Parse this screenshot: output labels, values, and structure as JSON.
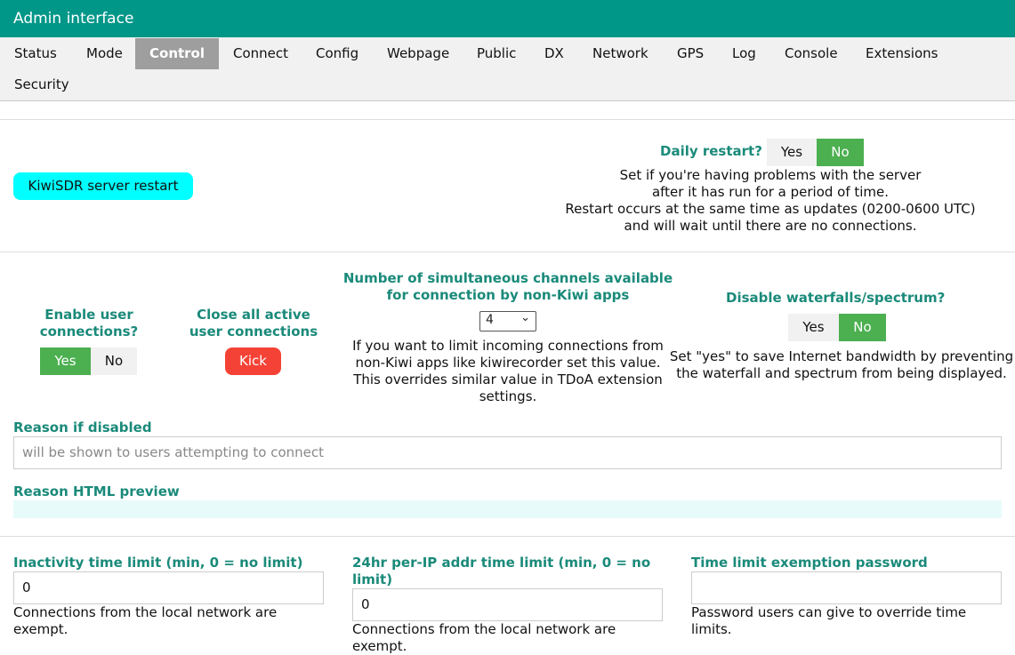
{
  "header": {
    "title": "Admin interface"
  },
  "tabs": [
    {
      "label": "Status"
    },
    {
      "label": "Mode"
    },
    {
      "label": "Control"
    },
    {
      "label": "Connect"
    },
    {
      "label": "Config"
    },
    {
      "label": "Webpage"
    },
    {
      "label": "Public"
    },
    {
      "label": "DX"
    },
    {
      "label": "Network"
    },
    {
      "label": "GPS"
    },
    {
      "label": "Log"
    },
    {
      "label": "Console"
    },
    {
      "label": "Extensions"
    },
    {
      "label": "Security"
    }
  ],
  "active_tab": "Control",
  "restart": {
    "button_label": "KiwiSDR server restart",
    "daily_label": "Daily restart?",
    "yes": "Yes",
    "no": "No",
    "selected": "No",
    "desc_lines": [
      "Set if you're having problems with the server",
      "after it has run for a period of time.",
      "Restart occurs at the same time as updates (0200-0600 UTC)",
      "and will wait until there are no connections."
    ]
  },
  "connections": {
    "enable_label_1": "Enable user",
    "enable_label_2": "connections?",
    "yes": "Yes",
    "no": "No",
    "enable_selected": "Yes",
    "close_label_1": "Close all active",
    "close_label_2": "user connections",
    "kick_label": "Kick",
    "channels_label_1": "Number of simultaneous channels available",
    "channels_label_2": "for connection by non-Kiwi apps",
    "channels_value": "4",
    "channels_desc": [
      "If you want to limit incoming connections from",
      "non-Kiwi apps like kiwirecorder set this value.",
      "This overrides similar value in TDoA extension",
      "settings."
    ],
    "waterfall_label": "Disable waterfalls/spectrum?",
    "waterfall_selected": "No",
    "waterfall_desc": [
      "Set \"yes\" to save Internet bandwidth by preventing",
      "the waterfall and spectrum from being displayed."
    ]
  },
  "reason": {
    "label": "Reason if disabled",
    "placeholder": "will be shown to users attempting to connect",
    "preview_label": "Reason HTML preview"
  },
  "limits": {
    "inactivity_label": "Inactivity time limit (min, 0 = no limit)",
    "inactivity_value": "0",
    "inactivity_desc_1": "Connections from the local network are",
    "inactivity_desc_2": "exempt.",
    "ip_label_1": "24hr per-IP addr time limit (min, 0 = no",
    "ip_label_2": "limit)",
    "ip_value": "0",
    "ip_desc_1": "Connections from the local network are",
    "ip_desc_2": "exempt.",
    "password_label": "Time limit exemption password",
    "password_value": "",
    "password_desc_1": "Password users can give to override time",
    "password_desc_2": "limits."
  }
}
